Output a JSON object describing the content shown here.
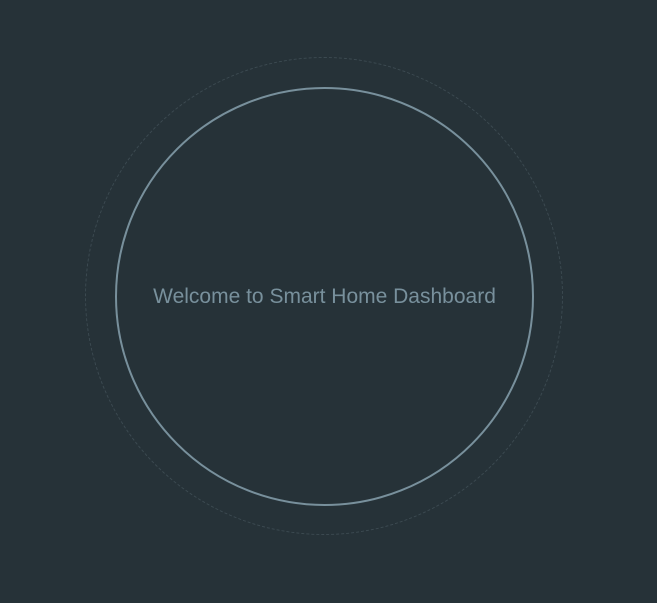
{
  "welcome": {
    "message": "Welcome to Smart Home Dashboard"
  },
  "colors": {
    "background": "#263238",
    "ring": "#78909c",
    "outer_ring": "#3c4a51",
    "text": "#78909c"
  }
}
